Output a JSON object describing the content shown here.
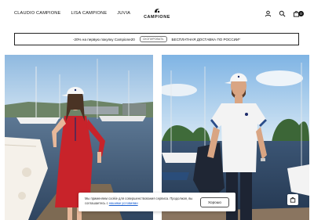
{
  "header": {
    "nav": [
      "CLAUDIO CAMPIONE",
      "LISA CAMPIONE",
      "JUVIA"
    ],
    "logo": "CAMPIONE",
    "cart_count": "0"
  },
  "promo": {
    "discount_text": "-20% на первую покупку Campione20",
    "copy_button": "СКОПИРОВАТЬ",
    "delivery_text": "БЕСПЛАТНАЯ ДОСТАВКА ПО РОССИИ*"
  },
  "cookie": {
    "text": "Мы применяем cookie для совершенствования сервиса. Продолжая, вы соглашаетесь с",
    "link": "нашими условиями",
    "accept": "Хорошо"
  },
  "colors": {
    "dress_red": "#c8232a",
    "tshirt_white": "#f3f3f3",
    "sky": "#a9cbe6",
    "water": "#49617a"
  },
  "icons": [
    "user-icon",
    "search-icon",
    "cart-icon",
    "bag-icon"
  ]
}
